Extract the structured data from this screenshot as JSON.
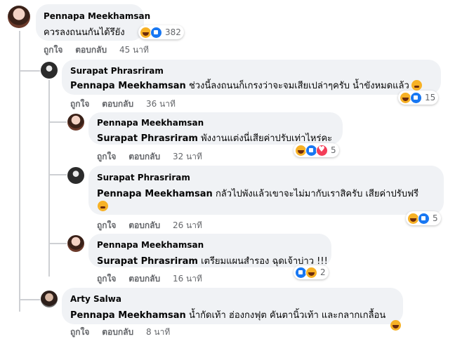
{
  "comments": [
    {
      "author": "Pennapa Meekhamsan",
      "text": "ควรลงถนนกันได้รึยัง",
      "reaction_count": "382",
      "like": "ถูกใจ",
      "reply": "ตอบกลับ",
      "time": "45 นาที"
    },
    {
      "author": "Surapat Phrasriram",
      "mention": "Pennapa Meekhamsan",
      "text": "ช่วงนี้ลงถนนก็เกรงว่าจะจมเสียเปล่าๆครับ น้ำขังหมดแล้ว",
      "reaction_count": "15",
      "like": "ถูกใจ",
      "reply": "ตอบกลับ",
      "time": "36 นาที"
    },
    {
      "author": "Pennapa Meekhamsan",
      "mention": "Surapat Phrasriram",
      "text": "พังงานแต่งนี่เสียค่าปรับเท่าไหร่คะ",
      "reaction_count": "5",
      "like": "ถูกใจ",
      "reply": "ตอบกลับ",
      "time": "32 นาที"
    },
    {
      "author": "Surapat Phrasriram",
      "mention": "Pennapa Meekhamsan",
      "text": "กลัวไปพังแล้วเขาจะไม่มากับเราสิครับ เสียค่าปรับฟรี",
      "reaction_count": "5",
      "like": "ถูกใจ",
      "reply": "ตอบกลับ",
      "time": "26 นาที"
    },
    {
      "author": "Pennapa Meekhamsan",
      "mention": "Surapat Phrasriram",
      "text": "เตรียมแผนสำรอง ฉุดเจ้าบ่าว !!!",
      "reaction_count": "2",
      "like": "ถูกใจ",
      "reply": "ตอบกลับ",
      "time": "16 นาที"
    },
    {
      "author": "Arty Salwa",
      "mention": "Pennapa Meekhamsan",
      "text": "น้ำกัดเท้า ฮ่องกงฟุต คันตานิ้วเท้า และกลากเกลื้อน",
      "like": "ถูกใจ",
      "reply": "ตอบกลับ",
      "time": "8 นาที"
    }
  ],
  "colors": {
    "bubble": "#f0f2f5",
    "meta_text": "#65676b",
    "thread_line": "#ced0d4",
    "like_blue": "#1877f2",
    "haha_yellow": "#f7b125",
    "love_red": "#f33e58"
  }
}
